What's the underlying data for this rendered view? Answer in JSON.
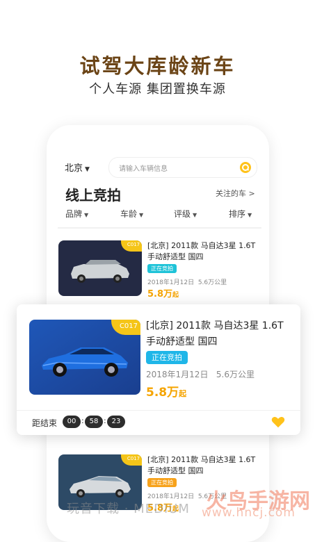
{
  "headline": "试驾大库龄新车",
  "subline": "个人车源 集团置换车源",
  "topbar": {
    "city": "北京",
    "search_placeholder": "请输入车辆信息"
  },
  "section": {
    "title": "线上竞拍",
    "follow": "关注的车 >"
  },
  "filters": [
    "品牌",
    "车龄",
    "评级",
    "排序"
  ],
  "listings": [
    {
      "tag": "C017",
      "title": "[北京] 2011款 马自达3星 1.6T 手动舒适型 国四",
      "status": "正在竞拍",
      "status_color": "#1fc3d8",
      "date": "2018年1月12日",
      "mileage": "5.6万公里",
      "price": "5.8万",
      "price_unit": "起"
    },
    {
      "tag": "C017",
      "title": "[北京] 2011款 马自达3星 1.6T 手动舒适型 国四",
      "status": "正在竞拍",
      "status_color": "#f7a21b",
      "date": "2018年1月12日",
      "mileage": "5.6万公里",
      "price": "5.8万",
      "price_unit": "起"
    }
  ],
  "featured": {
    "tag": "C017",
    "title_line1": "[北京] 2011款 马自达3星 1.6T",
    "title_line2": "手动舒适型 国四",
    "status": "正在竞拍",
    "date": "2018年1月12日",
    "mileage": "5.6万公里",
    "price": "5.8万",
    "price_unit": "起",
    "countdown_label": "距结束",
    "hours": "00",
    "minutes": "58",
    "seconds": "23"
  },
  "watermarks": {
    "left": "玩音下载 · MEDIUM",
    "right": "火鸟手游网",
    "url": "www.hncj.com"
  },
  "colors": {
    "headline": "#6b4416",
    "accent": "#f5c518",
    "price": "#f5a400",
    "status_blue": "#1fb6e8"
  }
}
